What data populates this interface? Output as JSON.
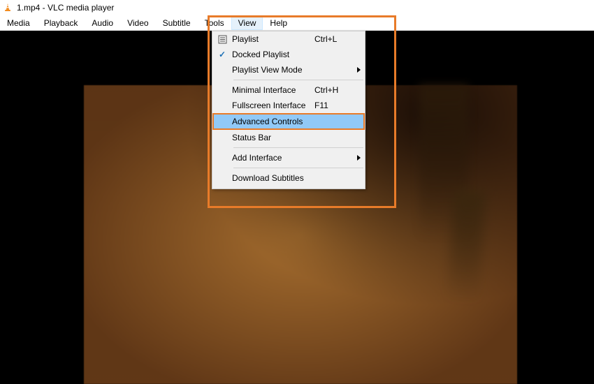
{
  "titlebar": {
    "title": "1.mp4 - VLC media player"
  },
  "menubar": {
    "items": [
      {
        "label": "Media"
      },
      {
        "label": "Playback"
      },
      {
        "label": "Audio"
      },
      {
        "label": "Video"
      },
      {
        "label": "Subtitle"
      },
      {
        "label": "Tools"
      },
      {
        "label": "View",
        "active": true
      },
      {
        "label": "Help"
      }
    ]
  },
  "viewMenu": {
    "playlist": {
      "label": "Playlist",
      "shortcut": "Ctrl+L"
    },
    "dockedPlaylist": {
      "label": "Docked Playlist"
    },
    "playlistViewMode": {
      "label": "Playlist View Mode"
    },
    "minimalInterface": {
      "label": "Minimal Interface",
      "shortcut": "Ctrl+H"
    },
    "fullscreenInterface": {
      "label": "Fullscreen Interface",
      "shortcut": "F11"
    },
    "advancedControls": {
      "label": "Advanced Controls"
    },
    "statusBar": {
      "label": "Status Bar"
    },
    "addInterface": {
      "label": "Add Interface"
    },
    "downloadSubtitles": {
      "label": "Download Subtitles"
    }
  }
}
